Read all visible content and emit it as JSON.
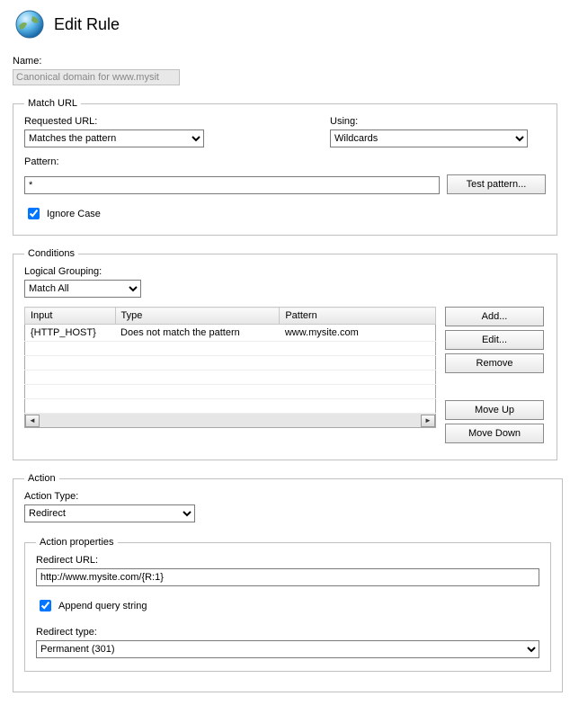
{
  "header": {
    "title": "Edit Rule"
  },
  "name": {
    "label": "Name:",
    "value": "Canonical domain for www.mysit"
  },
  "match": {
    "legend": "Match URL",
    "requested_label": "Requested URL:",
    "requested_value": "Matches the pattern",
    "using_label": "Using:",
    "using_value": "Wildcards",
    "pattern_label": "Pattern:",
    "pattern_value": "*",
    "test_btn": "Test pattern...",
    "ignore_case_label": "Ignore Case"
  },
  "conditions": {
    "legend": "Conditions",
    "logical_label": "Logical Grouping:",
    "logical_value": "Match All",
    "headers": {
      "input": "Input",
      "type": "Type",
      "pattern": "Pattern"
    },
    "rows": [
      {
        "input": "{HTTP_HOST}",
        "type": "Does not match the pattern",
        "pattern": "www.mysite.com"
      }
    ],
    "buttons": {
      "add": "Add...",
      "edit": "Edit...",
      "remove": "Remove",
      "moveup": "Move Up",
      "movedown": "Move Down"
    }
  },
  "action": {
    "legend": "Action",
    "type_label": "Action Type:",
    "type_value": "Redirect",
    "props_legend": "Action properties",
    "redirect_url_label": "Redirect URL:",
    "redirect_url_value": "http://www.mysite.com/{R:1}",
    "append_label": "Append query string",
    "redirect_type_label": "Redirect type:",
    "redirect_type_value": "Permanent (301)"
  }
}
